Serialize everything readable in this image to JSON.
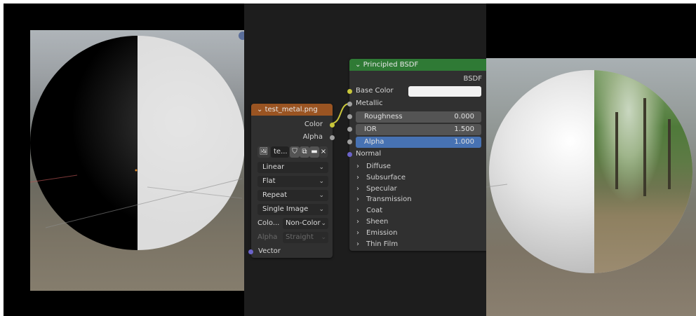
{
  "image_node": {
    "title": "test_metal.png",
    "outputs": {
      "color": "Color",
      "alpha": "Alpha"
    },
    "image_name": "te...",
    "interpolation": "Linear",
    "projection": "Flat",
    "extension": "Repeat",
    "source": "Single Image",
    "color_space_label": "Colo...",
    "color_space_value": "Non-Color",
    "alpha_label": "Alpha",
    "alpha_value": "Straight",
    "vector_label": "Vector"
  },
  "bsdf_node": {
    "title": "Principled BSDF",
    "output": "BSDF",
    "base_color_label": "Base Color",
    "metallic_label": "Metallic",
    "roughness": {
      "label": "Roughness",
      "value": "0.000"
    },
    "ior": {
      "label": "IOR",
      "value": "1.500"
    },
    "alpha": {
      "label": "Alpha",
      "value": "1.000"
    },
    "normal_label": "Normal",
    "panels": [
      "Diffuse",
      "Subsurface",
      "Specular",
      "Transmission",
      "Coat",
      "Sheen",
      "Emission",
      "Thin Film"
    ]
  },
  "colors": {
    "image_header": "#9a5422",
    "bsdf_header": "#2f7a35",
    "alpha_field": "#4772b3",
    "editor_bg": "#1d1d1d"
  }
}
